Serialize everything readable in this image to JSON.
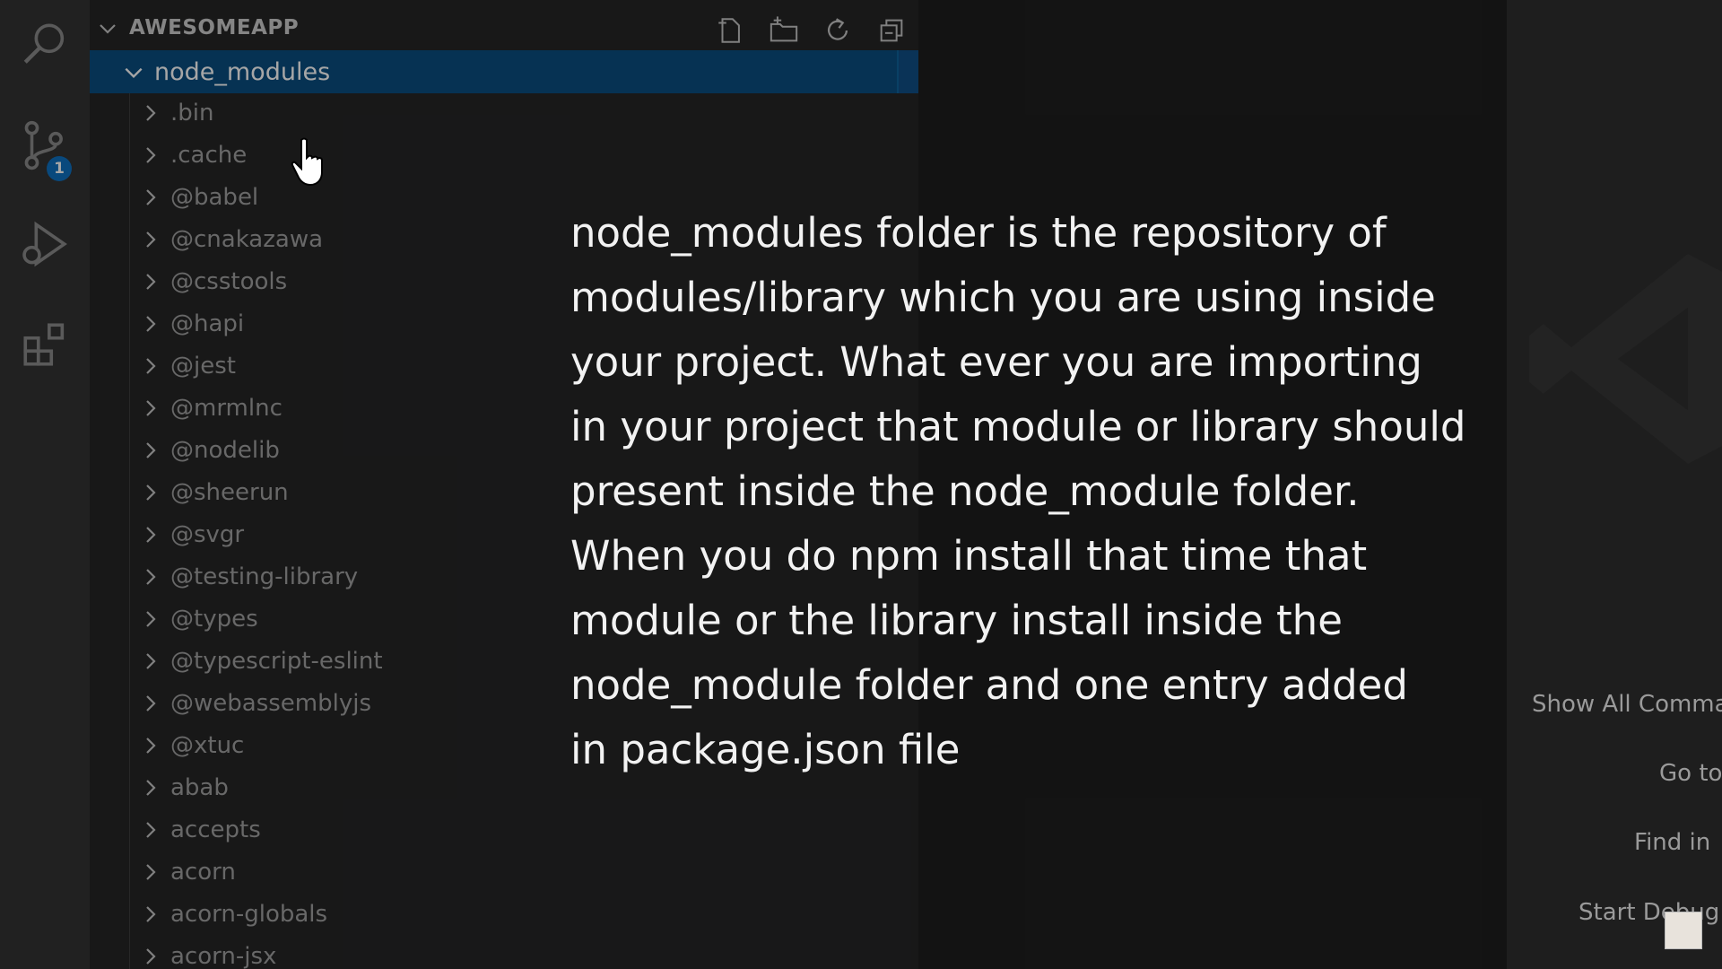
{
  "explorer": {
    "title": "AWESOMEAPP",
    "selected_folder": "node_modules",
    "badge_count": "1",
    "items": [
      ".bin",
      ".cache",
      "@babel",
      "@cnakazawa",
      "@csstools",
      "@hapi",
      "@jest",
      "@mrmlnc",
      "@nodelib",
      "@sheerun",
      "@svgr",
      "@testing-library",
      "@types",
      "@typescript-eslint",
      "@webassemblyjs",
      "@xtuc",
      "abab",
      "accepts",
      "acorn",
      "acorn-globals",
      "acorn-jsx"
    ]
  },
  "caption": {
    "lines": [
      "node_modules folder is the repository of",
      "modules/library which you are using inside",
      "your project. What ever you are importing",
      "in your project that module or library should",
      "present inside the node_module folder.",
      "When you do npm install that time that",
      "module or the library install inside the",
      "node_module folder and one entry added",
      "in package.json file"
    ]
  },
  "shortcuts": {
    "show_all": "Show All Comma",
    "go_to": "Go to",
    "find_in": "Find in",
    "start_debug": "Start Debug"
  },
  "icons": {
    "activity": [
      "search-icon",
      "source-control-icon",
      "run-debug-icon",
      "extensions-icon"
    ],
    "header": [
      "new-file-icon",
      "new-folder-icon",
      "refresh-icon",
      "collapse-all-icon"
    ]
  },
  "colors": {
    "selection": "#0a4d80",
    "badge": "#0e70c0"
  }
}
